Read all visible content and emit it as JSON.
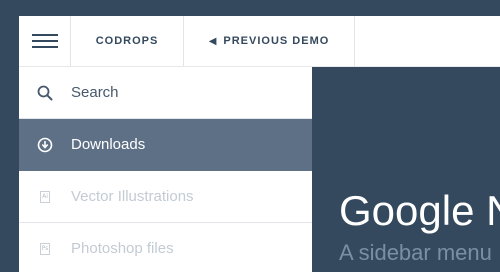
{
  "header": {
    "codrops_label": "CODROPS",
    "prev_demo_arrow": "🡐",
    "prev_demo_label": "PREVIOUS DEMO"
  },
  "sidebar": {
    "items": [
      {
        "label": "Search",
        "icon": "search-icon"
      },
      {
        "label": "Downloads",
        "icon": "download-icon",
        "active": true
      },
      {
        "label": "Vector Illustrations",
        "icon": "ai-file-icon",
        "icon_text": "Ai"
      },
      {
        "label": "Photoshop files",
        "icon": "ps-file-icon",
        "icon_text": "Ps"
      }
    ]
  },
  "main": {
    "title": "Google N",
    "subtitle": "A sidebar menu"
  },
  "colors": {
    "background": "#34495e",
    "active_item": "#5e7086",
    "text_dark": "#47586b",
    "text_muted": "#c3cbd3"
  }
}
